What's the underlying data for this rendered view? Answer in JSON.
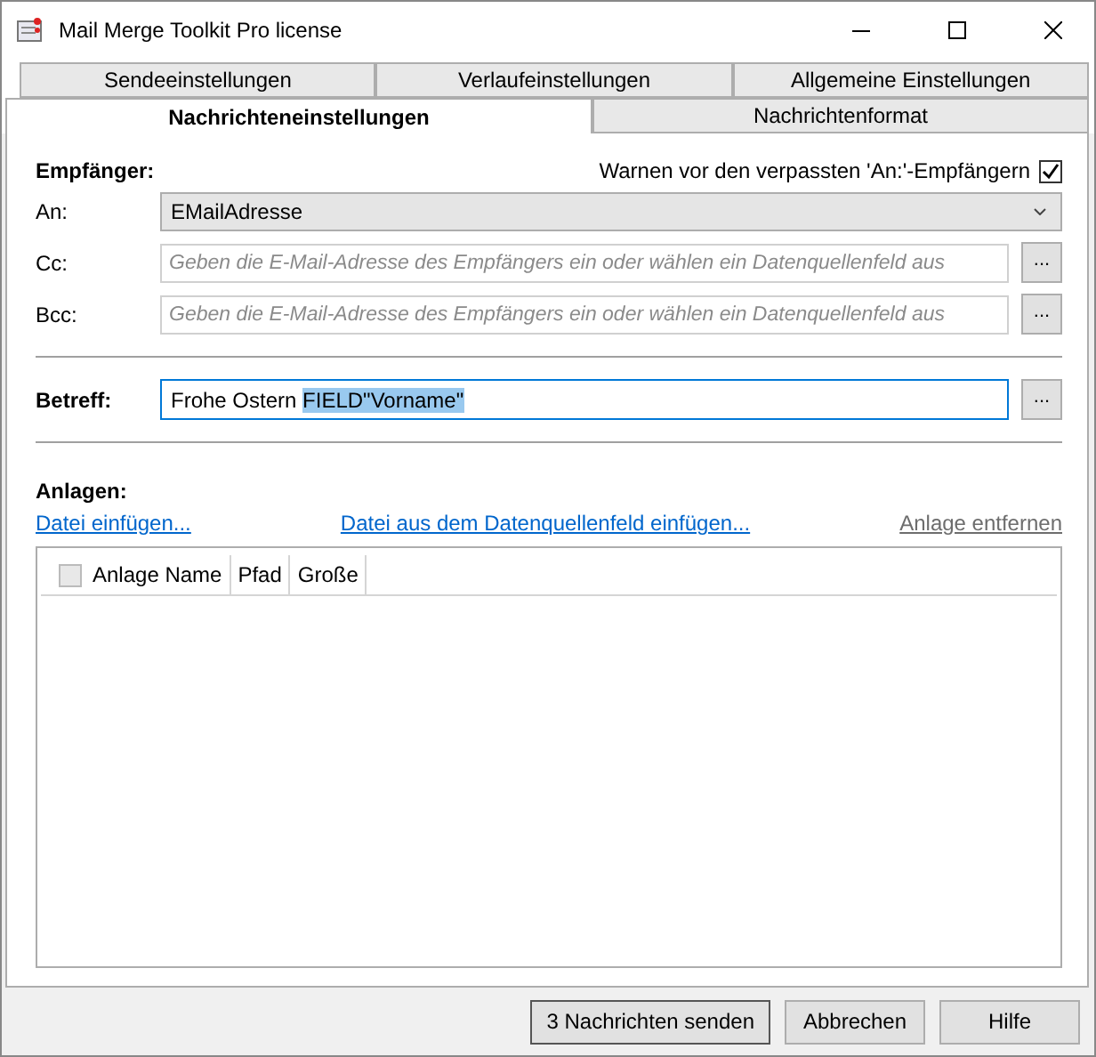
{
  "window": {
    "title": "Mail Merge Toolkit Pro license"
  },
  "tab_rows": [
    [
      {
        "label": "Sendeeinstellungen",
        "selected": false
      },
      {
        "label": "Verlaufeinstellungen",
        "selected": false
      },
      {
        "label": "Allgemeine Einstellungen",
        "selected": false
      }
    ],
    [
      {
        "label": "Nachrichteneinstellungen",
        "selected": true
      },
      {
        "label": "Nachrichtenformat",
        "selected": false
      }
    ]
  ],
  "recipients": {
    "heading": "Empfänger:",
    "warn_label": "Warnen vor den verpassten 'An:'-Empfängern",
    "warn_checked": true,
    "to": {
      "label": "An:",
      "value": "EMailAdresse"
    },
    "cc": {
      "label": "Cc:",
      "placeholder": "Geben die E-Mail-Adresse des Empfängers ein oder wählen ein Datenquellenfeld aus",
      "button": "..."
    },
    "bcc": {
      "label": "Bcc:",
      "placeholder": "Geben die E-Mail-Adresse des Empfängers ein oder wählen ein Datenquellenfeld aus",
      "button": "..."
    }
  },
  "subject": {
    "label": "Betreff:",
    "value": "Frohe Ostern",
    "selected_value": "FIELD\"Vorname\"",
    "button": "..."
  },
  "attachments": {
    "heading": "Anlagen:",
    "links": [
      {
        "label": "Datei einfügen...",
        "disabled": false
      },
      {
        "label": "Datei aus dem Datenquellenfeld einfügen...",
        "disabled": false
      },
      {
        "label": "Anlage entfernen",
        "disabled": true
      }
    ],
    "columns": [
      "Anlage Name",
      "Pfad",
      "Große"
    ],
    "select_all_checked": false
  },
  "buttons": [
    "3 Nachrichten senden",
    "Abbrechen",
    "Hilfe"
  ]
}
